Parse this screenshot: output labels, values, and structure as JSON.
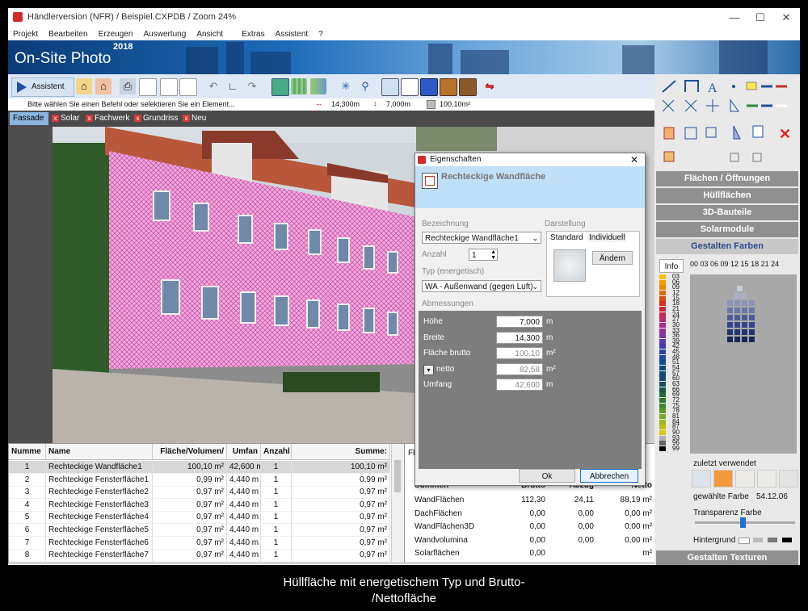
{
  "window": {
    "title": "Händlerversion (NFR) / Beispiel.CXPDB / Zoom 24%"
  },
  "menu": [
    "Projekt",
    "Bearbeiten",
    "Erzeugen",
    "Auswertung",
    "Ansicht",
    "Extras",
    "Assistent",
    "?"
  ],
  "banner": {
    "app_name": "On-Site Photo",
    "year": "2018"
  },
  "toolbar": {
    "assistant_label": "Assistent"
  },
  "status": {
    "hint": "Bitte wählen Sie einen Befehl oder selektieren Sie ein Element...",
    "width": "14,300m",
    "height": "7,000m",
    "area": "100,10m²"
  },
  "tabs": [
    {
      "label": "Fassade",
      "active": true
    },
    {
      "label": "Solar"
    },
    {
      "label": "Fachwerk"
    },
    {
      "label": "Grundriss"
    },
    {
      "label": "Neu"
    }
  ],
  "table": {
    "headers": [
      "Numme",
      "Name",
      "Fläche/Volumen/",
      "Umfan",
      "Anzahl",
      "Summe:"
    ],
    "rows": [
      [
        "1",
        "Rechteckige Wandfläche1",
        "100,10 m²",
        "42,600 m",
        "1",
        "100,10 m²"
      ],
      [
        "2",
        "Rechteckige Fensterfläche1",
        "0,99 m²",
        "4,440 m",
        "1",
        "0,99 m²"
      ],
      [
        "3",
        "Rechteckige Fensterfläche2",
        "0,97 m²",
        "4,440 m",
        "1",
        "0,97 m²"
      ],
      [
        "4",
        "Rechteckige Fensterfläche3",
        "0,97 m²",
        "4,440 m",
        "1",
        "0,97 m²"
      ],
      [
        "5",
        "Rechteckige Fensterfläche4",
        "0,97 m²",
        "4,440 m",
        "1",
        "0,97 m²"
      ],
      [
        "6",
        "Rechteckige Fensterfläche5",
        "0,97 m²",
        "4,440 m",
        "1",
        "0,97 m²"
      ],
      [
        "7",
        "Rechteckige Fensterfläche6",
        "0,97 m²",
        "4,440 m",
        "1",
        "0,97 m²"
      ],
      [
        "8",
        "Rechteckige Fensterfläche7",
        "0,97 m²",
        "4,440 m",
        "1",
        "0,97 m²"
      ]
    ]
  },
  "summary": {
    "tab_label": "Fl",
    "headers": [
      "Summen",
      "Brutto",
      "Abzug",
      "Netto"
    ],
    "rows": [
      [
        "WandFlächen",
        "112,30",
        "24,11",
        "88,19 m²"
      ],
      [
        "DachFlächen",
        "0,00",
        "0,00",
        "0,00 m²"
      ],
      [
        "WandFlächen3D",
        "0,00",
        "0,00",
        "0,00 m²"
      ],
      [
        "Wandvolumina",
        "0,00",
        "0,00",
        "0,00 m²"
      ],
      [
        "Solarflächen",
        "0,00",
        "",
        "m²"
      ]
    ]
  },
  "dialog": {
    "title": "Eigenschaften",
    "header": "Rechteckige Wandfläche",
    "bezeichnung_label": "Bezeichnung",
    "bezeichnung_value": "Rechteckige Wandfläche1",
    "anzahl_label": "Anzahl",
    "anzahl_value": "1",
    "typ_label": "Typ (energetisch)",
    "typ_value": "WA - Außenwand (gegen Luft)",
    "darstellung_label": "Darstellung",
    "darst_tabs": [
      "Standard",
      "Individuell"
    ],
    "aendern_label": "Ändern",
    "abmessungen_label": "Abmessungen",
    "fields": [
      {
        "label": "Höhe",
        "value": "7,000",
        "unit": "m"
      },
      {
        "label": "Breite",
        "value": "14,300",
        "unit": "m"
      },
      {
        "label": "Fläche brutto",
        "value": "100,10",
        "unit": "m²"
      },
      {
        "label": "netto",
        "value": "82,58",
        "unit": "m²"
      },
      {
        "label": "Umfang",
        "value": "42,600",
        "unit": "m"
      }
    ],
    "ok_label": "Ok",
    "cancel_label": "Abbrechen"
  },
  "right_panel": {
    "sections": [
      "Flächen / Öffnungen",
      "Hüllflächen",
      "3D-Bauteile",
      "Solarmodule",
      "Gestalten Farben"
    ],
    "textures_label": "Gestalten Texturen",
    "info_label": "Info",
    "hue_labels": "00 03 06 09 12 15 18 21 24",
    "color_numbers": [
      "03",
      "06",
      "09",
      "12",
      "15",
      "18",
      "21",
      "24",
      "27",
      "30",
      "33",
      "36",
      "39",
      "42",
      "45",
      "48",
      "51",
      "54",
      "57",
      "60",
      "63",
      "66",
      "69",
      "72",
      "75",
      "78",
      "81",
      "84",
      "87",
      "90",
      "93",
      "96",
      "99"
    ],
    "swatch_colors": [
      "#f5c400",
      "#f0a000",
      "#e88a00",
      "#e06a00",
      "#d84a10",
      "#d43020",
      "#c8283a",
      "#c02a55",
      "#b82a70",
      "#a82a88",
      "#90309a",
      "#7838a8",
      "#5a3ab0",
      "#403cb0",
      "#2c42a8",
      "#1c4aa0",
      "#124e90",
      "#0c4a80",
      "#104c76",
      "#124e6a",
      "#12505c",
      "#1a5848",
      "#1e6a3c",
      "#2a7a30",
      "#3e8a28",
      "#5a9a22",
      "#7aa81e",
      "#9ab61a",
      "#bcc018",
      "#d8c814",
      "#b0b0b0",
      "#606060",
      "#000000"
    ],
    "recent_label": "zuletzt verwendet",
    "recent_colors": [
      "#dde3ea",
      "#f39a3a",
      "#ecebe6",
      "#ecebe6",
      "#e3e3e1"
    ],
    "selected_label": "gewählte Farbe",
    "selected_value": "54.12.06",
    "transparency_label": "Transparenz Farbe",
    "background_label": "Hintergrund"
  },
  "caption": {
    "line1": "Hüllfläche mit energetischem Typ und Brutto-",
    "line2": "/Nettofläche"
  }
}
